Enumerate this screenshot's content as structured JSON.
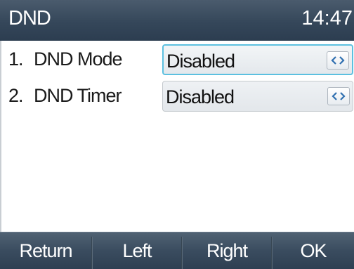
{
  "header": {
    "title": "DND",
    "time": "14:47"
  },
  "settings": [
    {
      "index": "1.",
      "label": "DND Mode",
      "value": "Disabled",
      "focused": true
    },
    {
      "index": "2.",
      "label": "DND Timer",
      "value": "Disabled",
      "focused": false
    }
  ],
  "softkeys": {
    "return": "Return",
    "left": "Left",
    "right": "Right",
    "ok": "OK"
  },
  "icons": {
    "arrow": "left-right-arrow-icon"
  },
  "colors": {
    "header_bg": "#35475a",
    "focus_border": "#5cc0e0",
    "arrow_color": "#2f6fb0",
    "softkey_bg": "#3a4c5f"
  }
}
